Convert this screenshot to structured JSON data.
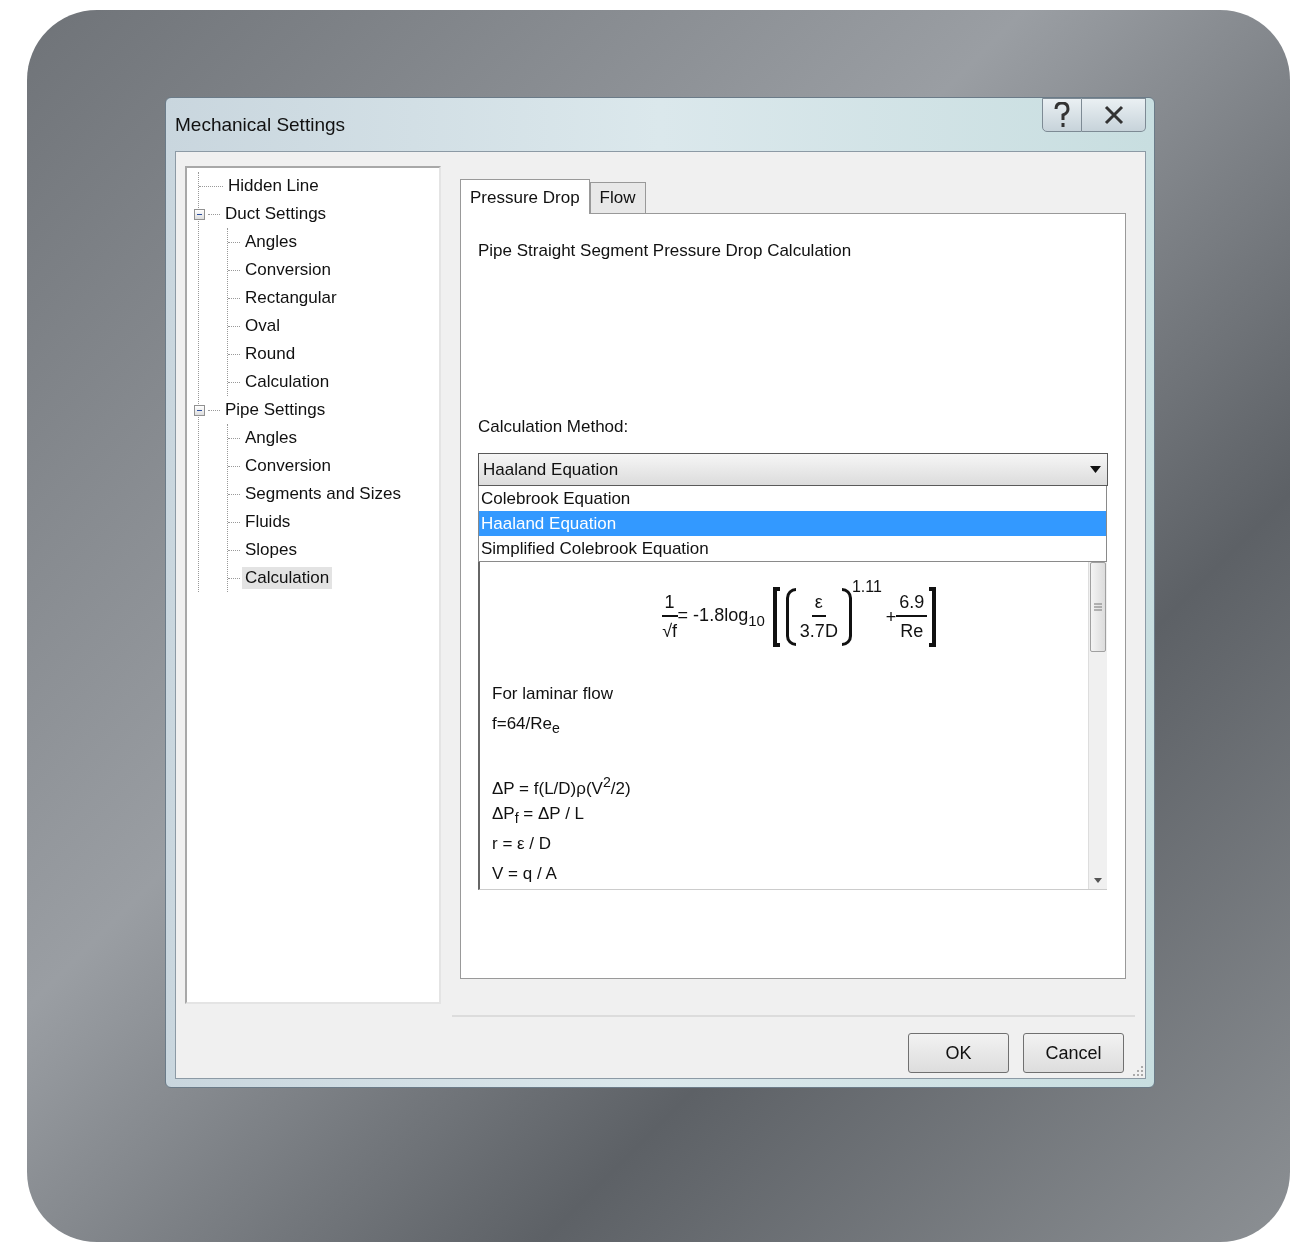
{
  "window": {
    "title": "Mechanical Settings"
  },
  "tree": [
    {
      "label": "Hidden Line",
      "selected": false
    },
    {
      "label": "Duct Settings",
      "selected": false,
      "expanded": true,
      "children": [
        {
          "label": "Angles",
          "selected": false
        },
        {
          "label": "Conversion",
          "selected": false
        },
        {
          "label": "Rectangular",
          "selected": false
        },
        {
          "label": "Oval",
          "selected": false
        },
        {
          "label": "Round",
          "selected": false
        },
        {
          "label": "Calculation",
          "selected": false
        }
      ]
    },
    {
      "label": "Pipe Settings",
      "selected": false,
      "expanded": true,
      "children": [
        {
          "label": "Angles",
          "selected": false
        },
        {
          "label": "Conversion",
          "selected": false
        },
        {
          "label": "Segments and Sizes",
          "selected": false
        },
        {
          "label": "Fluids",
          "selected": false
        },
        {
          "label": "Slopes",
          "selected": false
        },
        {
          "label": "Calculation",
          "selected": true
        }
      ]
    }
  ],
  "tabs": [
    {
      "label": "Pressure Drop",
      "selected": true
    },
    {
      "label": "Flow",
      "selected": false
    }
  ],
  "panel": {
    "heading": "Pipe Straight Segment Pressure Drop Calculation",
    "method_label": "Calculation Method:",
    "dropdown": {
      "value": "Haaland Equation",
      "expanded": true,
      "options": [
        {
          "label": "Colebrook Equation",
          "selected": false
        },
        {
          "label": "Haaland Equation",
          "selected": true
        },
        {
          "label": "Simplified Colebrook Equation",
          "selected": false
        }
      ]
    },
    "formula": {
      "left_numerator": "1",
      "left_denominator": "√f",
      "equals": "= -1.8log$_{10}$",
      "inner_numerator": "ε",
      "inner_denominator": "3.7D",
      "exponent": "1.11",
      "plus": "+",
      "right_numerator": "6.9",
      "right_denominator": "Re"
    },
    "paragraphs": [
      [
        "For laminar flow",
        "f=64/Re$_{e}$"
      ],
      [
        "ΔP = f(L/D)ρ(V$^{2}$/2)",
        "ΔP$_{f}$ = ΔP / L",
        "r = ε / D",
        "V = q / A"
      ]
    ]
  },
  "buttons": [
    "OK",
    "Cancel"
  ]
}
